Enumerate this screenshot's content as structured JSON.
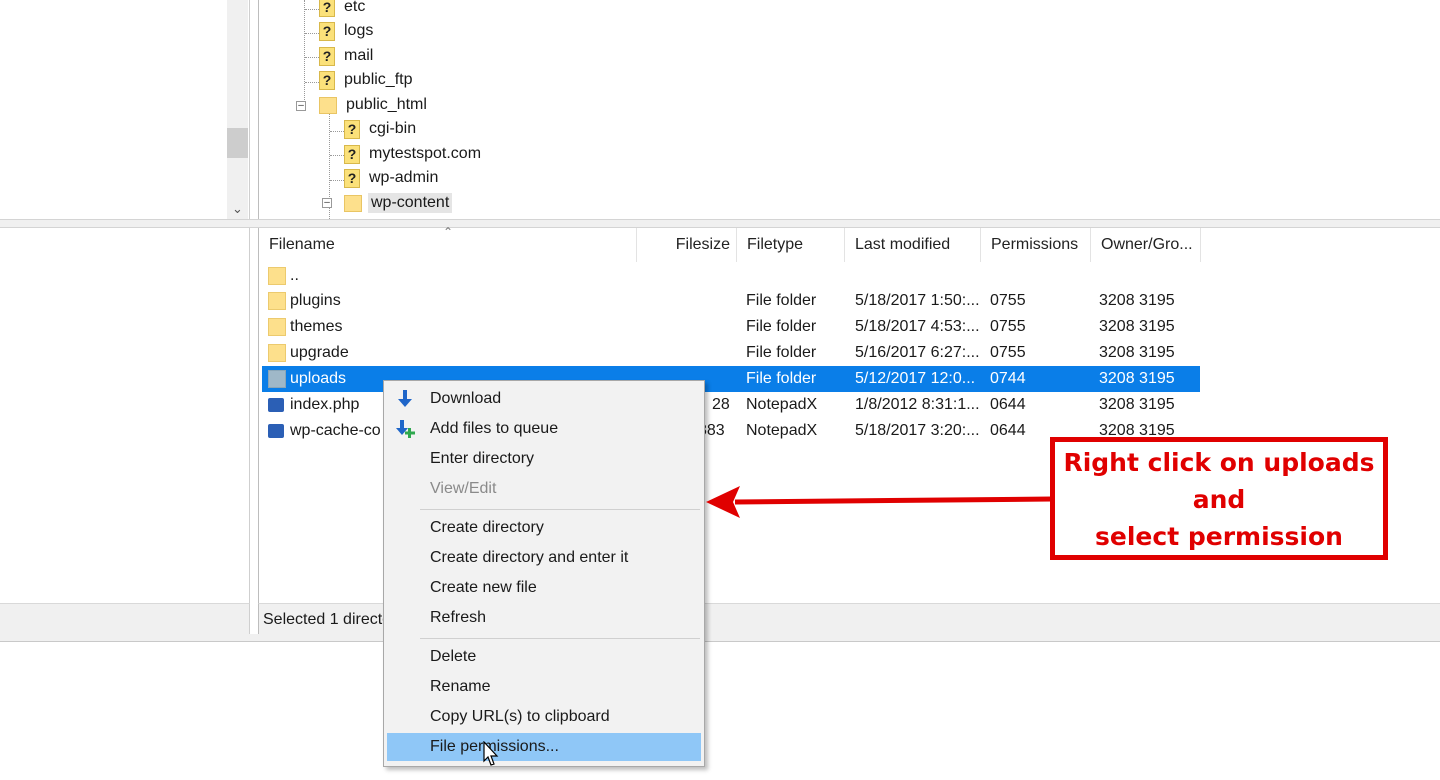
{
  "tree": {
    "items": [
      {
        "label": "etc",
        "icon": "question-folder-icon"
      },
      {
        "label": "logs",
        "icon": "question-folder-icon"
      },
      {
        "label": "mail",
        "icon": "question-folder-icon"
      },
      {
        "label": "public_ftp",
        "icon": "question-folder-icon"
      },
      {
        "label": "public_html",
        "icon": "folder-icon",
        "expanded": true
      },
      {
        "label": "cgi-bin",
        "icon": "question-folder-icon"
      },
      {
        "label": "mytestspot.com",
        "icon": "question-folder-icon"
      },
      {
        "label": "wp-admin",
        "icon": "question-folder-icon"
      },
      {
        "label": "wp-content",
        "icon": "folder-icon",
        "expanded": true,
        "selected": true
      }
    ]
  },
  "filelist": {
    "columns": [
      "Filename",
      "Filesize",
      "Filetype",
      "Last modified",
      "Permissions",
      "Owner/Gro..."
    ],
    "rows": [
      {
        "name": "..",
        "size": "",
        "type": "",
        "modified": "",
        "perms": "",
        "owner": ""
      },
      {
        "name": "plugins",
        "size": "",
        "type": "File folder",
        "modified": "5/18/2017 1:50:...",
        "perms": "0755",
        "owner": "3208 3195"
      },
      {
        "name": "themes",
        "size": "",
        "type": "File folder",
        "modified": "5/18/2017 4:53:...",
        "perms": "0755",
        "owner": "3208 3195"
      },
      {
        "name": "upgrade",
        "size": "",
        "type": "File folder",
        "modified": "5/16/2017 6:27:...",
        "perms": "0755",
        "owner": "3208 3195"
      },
      {
        "name": "uploads",
        "size": "",
        "type": "File folder",
        "modified": "5/12/2017 12:0...",
        "perms": "0744",
        "owner": "3208 3195",
        "selected": true
      },
      {
        "name": "index.php",
        "size": "28",
        "type": "NotepadX",
        "modified": "1/8/2012 8:31:1...",
        "perms": "0644",
        "owner": "3208 3195"
      },
      {
        "name": "wp-cache-co",
        "size": "883",
        "type": "NotepadX",
        "modified": "5/18/2017 3:20:...",
        "perms": "0644",
        "owner": "3208 3195"
      }
    ],
    "status": "Selected 1 directo"
  },
  "context_menu": {
    "items": [
      {
        "label": "Download",
        "icon": "download-arrow-icon"
      },
      {
        "label": "Add files to queue",
        "icon": "add-to-queue-icon"
      },
      {
        "label": "Enter directory"
      },
      {
        "label": "View/Edit",
        "disabled": true
      },
      {
        "label": "Create directory"
      },
      {
        "label": "Create directory and enter it"
      },
      {
        "label": "Create new file"
      },
      {
        "label": "Refresh"
      },
      {
        "label": "Delete"
      },
      {
        "label": "Rename"
      },
      {
        "label": "Copy URL(s) to clipboard"
      },
      {
        "label": "File permissions...",
        "hovered": true
      }
    ]
  },
  "callout": {
    "line1": "Right click on uploads",
    "line2": "and",
    "line3": "select permission",
    "color": "#e00000"
  },
  "colors": {
    "selection": "#0a7ee8",
    "menu_hover": "#8fc7f7",
    "folder": "#fde08c"
  }
}
